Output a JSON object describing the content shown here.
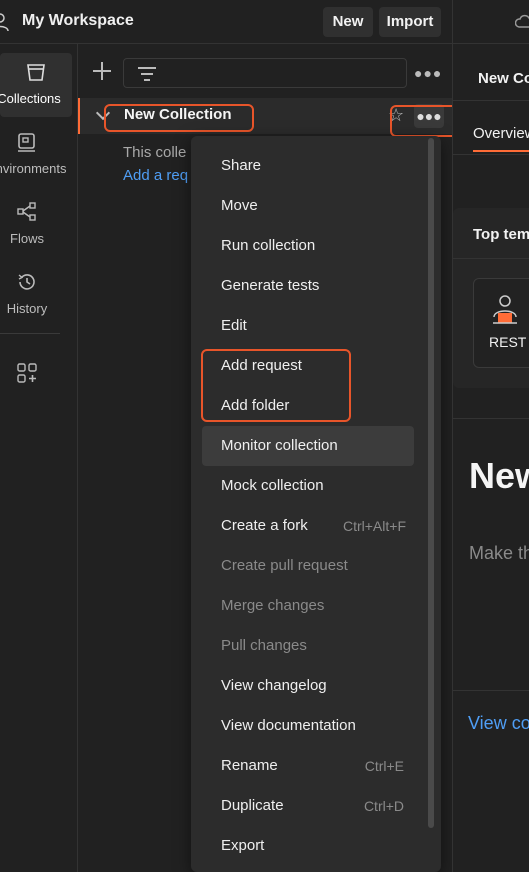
{
  "header": {
    "workspace_title": "My Workspace",
    "new_label": "New",
    "import_label": "Import"
  },
  "rail": {
    "items": [
      {
        "label": "Collections",
        "icon": "collections-icon",
        "active": true
      },
      {
        "label": "Environments",
        "icon": "environments-icon",
        "active": false
      },
      {
        "label": "Flows",
        "icon": "flows-icon",
        "active": false
      },
      {
        "label": "History",
        "icon": "history-icon",
        "active": false
      },
      {
        "label": "",
        "icon": "add-configure-icon",
        "active": false
      }
    ]
  },
  "sidebar": {
    "collection_name": "New Collection",
    "empty_description": "This colle",
    "empty_link": "Add a req"
  },
  "menu": {
    "items": [
      {
        "label": "Share",
        "shortcut": "",
        "disabled": false
      },
      {
        "label": "Move",
        "shortcut": "",
        "disabled": false
      },
      {
        "label": "Run collection",
        "shortcut": "",
        "disabled": false
      },
      {
        "label": "Generate tests",
        "shortcut": "",
        "disabled": false
      },
      {
        "label": "Edit",
        "shortcut": "",
        "disabled": false
      },
      {
        "label": "Add request",
        "shortcut": "",
        "disabled": false
      },
      {
        "label": "Add folder",
        "shortcut": "",
        "disabled": false
      },
      {
        "label": "Monitor collection",
        "shortcut": "",
        "disabled": false
      },
      {
        "label": "Mock collection",
        "shortcut": "",
        "disabled": false
      },
      {
        "label": "Create a fork",
        "shortcut": "Ctrl+Alt+F",
        "disabled": false
      },
      {
        "label": "Create pull request",
        "shortcut": "",
        "disabled": true
      },
      {
        "label": "Merge changes",
        "shortcut": "",
        "disabled": true
      },
      {
        "label": "Pull changes",
        "shortcut": "",
        "disabled": true
      },
      {
        "label": "View changelog",
        "shortcut": "",
        "disabled": false
      },
      {
        "label": "View documentation",
        "shortcut": "",
        "disabled": false
      },
      {
        "label": "Rename",
        "shortcut": "Ctrl+E",
        "disabled": false
      },
      {
        "label": "Duplicate",
        "shortcut": "Ctrl+D",
        "disabled": false
      },
      {
        "label": "Export",
        "shortcut": "",
        "disabled": false
      }
    ]
  },
  "main": {
    "tab_title": "New Co",
    "overview_tab": "Overview",
    "templates_title": "Top tem",
    "template_label": "REST A",
    "big_title": "New",
    "description": "Make th",
    "view_link": "View co"
  },
  "colors": {
    "accent": "#ff6c37",
    "link": "#4f9ef5",
    "highlight_box": "#e8552a"
  }
}
